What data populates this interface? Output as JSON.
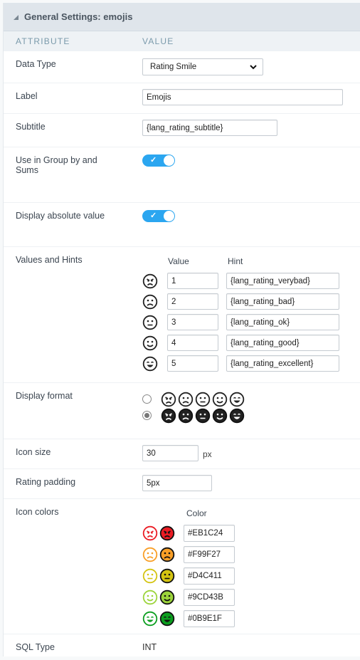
{
  "header": {
    "title": "General Settings: emojis",
    "collapse_icon": "triangle-collapse-icon"
  },
  "columns": {
    "attribute": "ATTRIBUTE",
    "value": "VALUE"
  },
  "data_type": {
    "label": "Data Type",
    "value": "Rating Smile"
  },
  "label_field": {
    "label": "Label",
    "value": "Emojis"
  },
  "subtitle": {
    "label": "Subtitle",
    "value": "{lang_rating_subtitle}"
  },
  "group_by": {
    "label": "Use in Group by and Sums",
    "checked": true
  },
  "absolute": {
    "label": "Display absolute value",
    "checked": true
  },
  "values_hints": {
    "label": "Values and Hints",
    "value_header": "Value",
    "hint_header": "Hint",
    "rows": [
      {
        "icon": "angry-face-icon",
        "value": "1",
        "hint": "{lang_rating_verybad}"
      },
      {
        "icon": "sad-face-icon",
        "value": "2",
        "hint": "{lang_rating_bad}"
      },
      {
        "icon": "neutral-face-icon",
        "value": "3",
        "hint": "{lang_rating_ok}"
      },
      {
        "icon": "smile-face-icon",
        "value": "4",
        "hint": "{lang_rating_good}"
      },
      {
        "icon": "grin-face-icon",
        "value": "5",
        "hint": "{lang_rating_excellent}"
      }
    ]
  },
  "display_format": {
    "label": "Display format",
    "options": [
      "outline",
      "solid"
    ],
    "selected": "solid"
  },
  "icon_size": {
    "label": "Icon size",
    "value": "30",
    "unit": "px"
  },
  "rating_padding": {
    "label": "Rating padding",
    "value": "5px"
  },
  "icon_colors": {
    "label": "Icon colors",
    "color_header": "Color",
    "rows": [
      {
        "color": "#EB1C24"
      },
      {
        "color": "#F99F27"
      },
      {
        "color": "#D4C411"
      },
      {
        "color": "#9CD43B"
      },
      {
        "color": "#0B9E1F"
      }
    ]
  },
  "sql_type": {
    "label": "SQL Type",
    "value": "INT"
  }
}
